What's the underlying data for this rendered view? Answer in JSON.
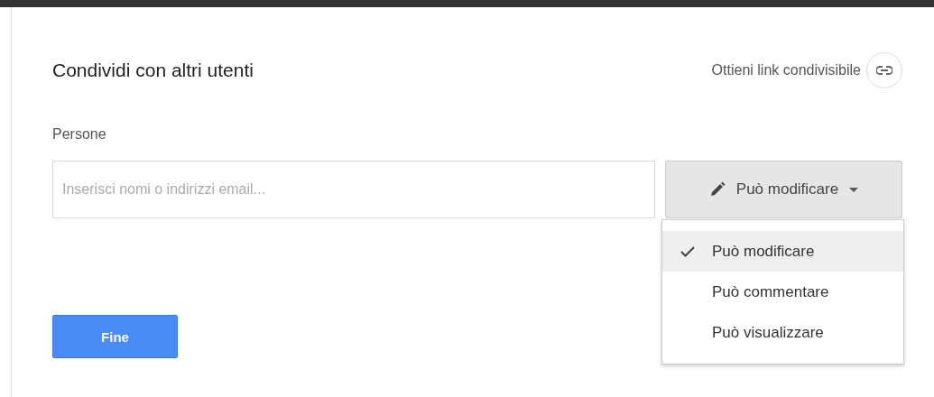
{
  "dialog": {
    "title": "Condividi con altri utenti",
    "share_link": "Ottieni link condivisibile"
  },
  "people": {
    "label": "Persone",
    "placeholder": "Inserisci nomi o indirizzi email...",
    "permission": {
      "value": "Può modificare",
      "expanded": true,
      "options": [
        {
          "label": "Può modificare",
          "selected": true
        },
        {
          "label": "Può commentare",
          "selected": false
        },
        {
          "label": "Può visualizzare",
          "selected": false
        }
      ]
    }
  },
  "buttons": {
    "done": "Fine"
  }
}
